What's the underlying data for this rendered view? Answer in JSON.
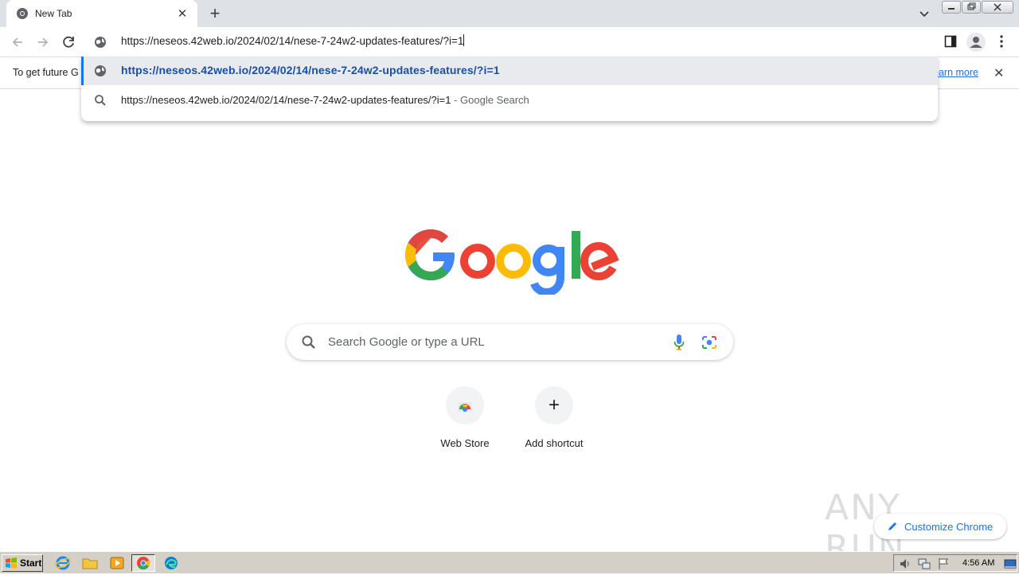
{
  "tab": {
    "title": "New Tab",
    "close_glyph": "✕"
  },
  "new_tab_glyph": "+",
  "omnibox": {
    "value": "https://neseos.42web.io/2024/02/14/nese-7-24w2-updates-features/?i=1"
  },
  "infobar": {
    "text": "To get future G",
    "link": "earn more",
    "close_glyph": "✕"
  },
  "suggestions": [
    {
      "text": "https://neseos.42web.io/2024/02/14/nese-7-24w2-updates-features/?i=1",
      "icon": "globe-icon"
    },
    {
      "text": "https://neseos.42web.io/2024/02/14/nese-7-24w2-updates-features/?i=1",
      "suffix": " - Google Search",
      "icon": "search-icon"
    }
  ],
  "search": {
    "placeholder": "Search Google or type a URL"
  },
  "shortcuts": [
    {
      "label": "Web Store"
    },
    {
      "label": "Add shortcut",
      "glyph": "+"
    }
  ],
  "customize": {
    "label": "Customize Chrome"
  },
  "watermark": {
    "text": "ANY RUN"
  },
  "taskbar": {
    "start_label": "Start",
    "clock": "4:56 AM"
  },
  "colors": {
    "accent": "#1a73e8",
    "google_blue": "#4285f4",
    "google_red": "#ea4335",
    "google_yellow": "#fbbc05",
    "google_green": "#34a853"
  }
}
